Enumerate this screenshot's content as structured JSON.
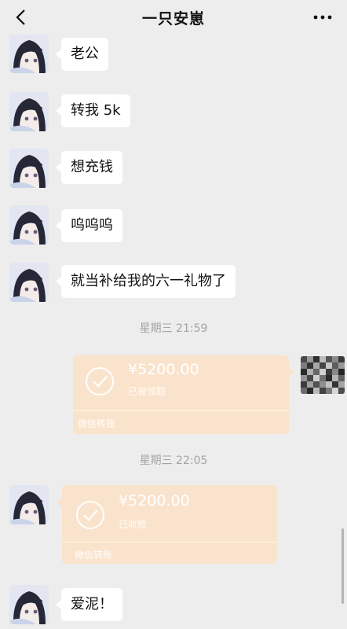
{
  "header": {
    "title": "一只安崽",
    "back_icon": "chevron-left-icon",
    "more_icon": "more-horizontal-icon"
  },
  "messages": [
    {
      "text": "老公"
    },
    {
      "text": "转我 5k"
    },
    {
      "text": "想充钱"
    },
    {
      "text": "呜呜呜"
    },
    {
      "text": "就当补给我的六一礼物了"
    },
    {
      "text": "爱泥！"
    }
  ],
  "timestamps": [
    "星期三 21:59",
    "星期三 22:05"
  ],
  "transfers": [
    {
      "amount": "¥5200.00",
      "status": "已被领取",
      "brand": "微信转账"
    },
    {
      "amount": "¥5200.00",
      "status": "已收款",
      "brand": "微信转账"
    }
  ],
  "colors": {
    "background": "#ededed",
    "bubble": "#ffffff",
    "transfer_received": "#fae3cc",
    "timestamp_text": "#a3a3a3"
  }
}
